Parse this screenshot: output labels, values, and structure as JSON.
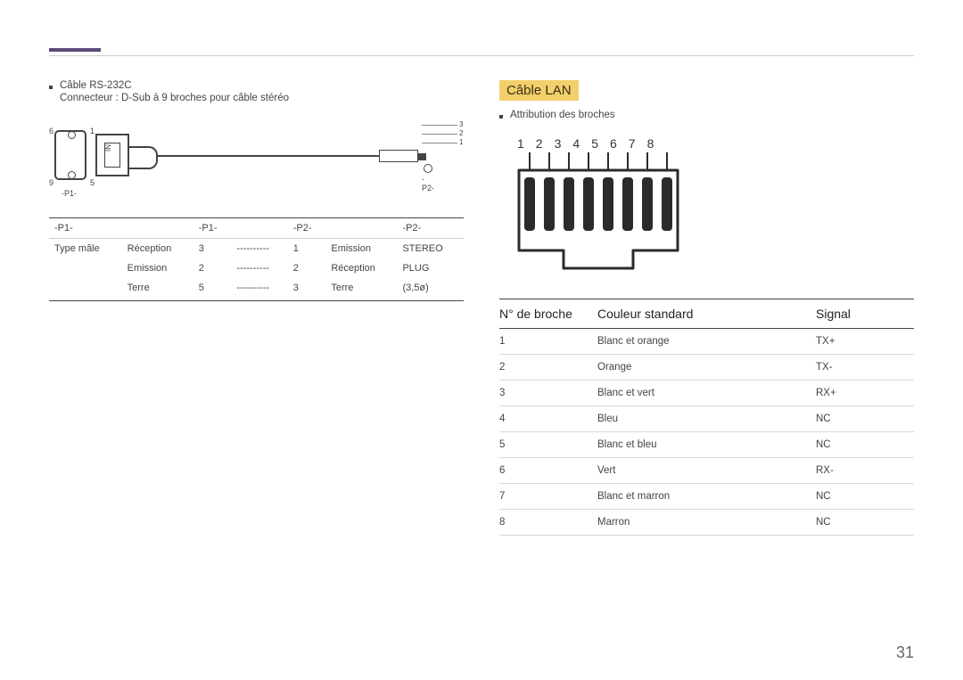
{
  "page_number": "31",
  "left": {
    "bullet_title": "Câble RS-232C",
    "connector_line": "Connecteur : D-Sub à 9 broches pour câble stéréo",
    "diagram": {
      "pins_left": {
        "p6": "6",
        "p1": "1",
        "p9": "9",
        "p5": "5"
      },
      "in_label": "IN",
      "p1_label": "-P1-",
      "jack_nums": {
        "n3": "3",
        "n2": "2",
        "n1": "1"
      },
      "p2_label": "-P2-"
    },
    "table": {
      "headers": [
        "-P1-",
        "-P1-",
        "",
        "-P2-",
        "",
        "-P2-"
      ],
      "rows": [
        [
          "Type mâle",
          "Réception",
          "3",
          "----------",
          "1",
          "Emission",
          "STEREO"
        ],
        [
          "",
          "Emission",
          "2",
          "----------",
          "2",
          "Réception",
          "PLUG"
        ],
        [
          "",
          "Terre",
          "5",
          "----------",
          "3",
          "Terre",
          "(3,5ø)"
        ]
      ]
    }
  },
  "right": {
    "section_title": "Câble LAN",
    "bullet": "Attribution des broches",
    "pin_numbers": [
      "1",
      "2",
      "3",
      "4",
      "5",
      "6",
      "7",
      "8"
    ],
    "lan_headers": {
      "c1": "N° de broche",
      "c2": "Couleur standard",
      "c3": "Signal"
    },
    "lan_rows": [
      {
        "pin": "1",
        "color": "Blanc et orange",
        "signal": "TX+"
      },
      {
        "pin": "2",
        "color": "Orange",
        "signal": "TX-"
      },
      {
        "pin": "3",
        "color": "Blanc et vert",
        "signal": "RX+"
      },
      {
        "pin": "4",
        "color": "Bleu",
        "signal": "NC"
      },
      {
        "pin": "5",
        "color": "Blanc et bleu",
        "signal": "NC"
      },
      {
        "pin": "6",
        "color": "Vert",
        "signal": "RX-"
      },
      {
        "pin": "7",
        "color": "Blanc et marron",
        "signal": "NC"
      },
      {
        "pin": "8",
        "color": "Marron",
        "signal": "NC"
      }
    ]
  }
}
